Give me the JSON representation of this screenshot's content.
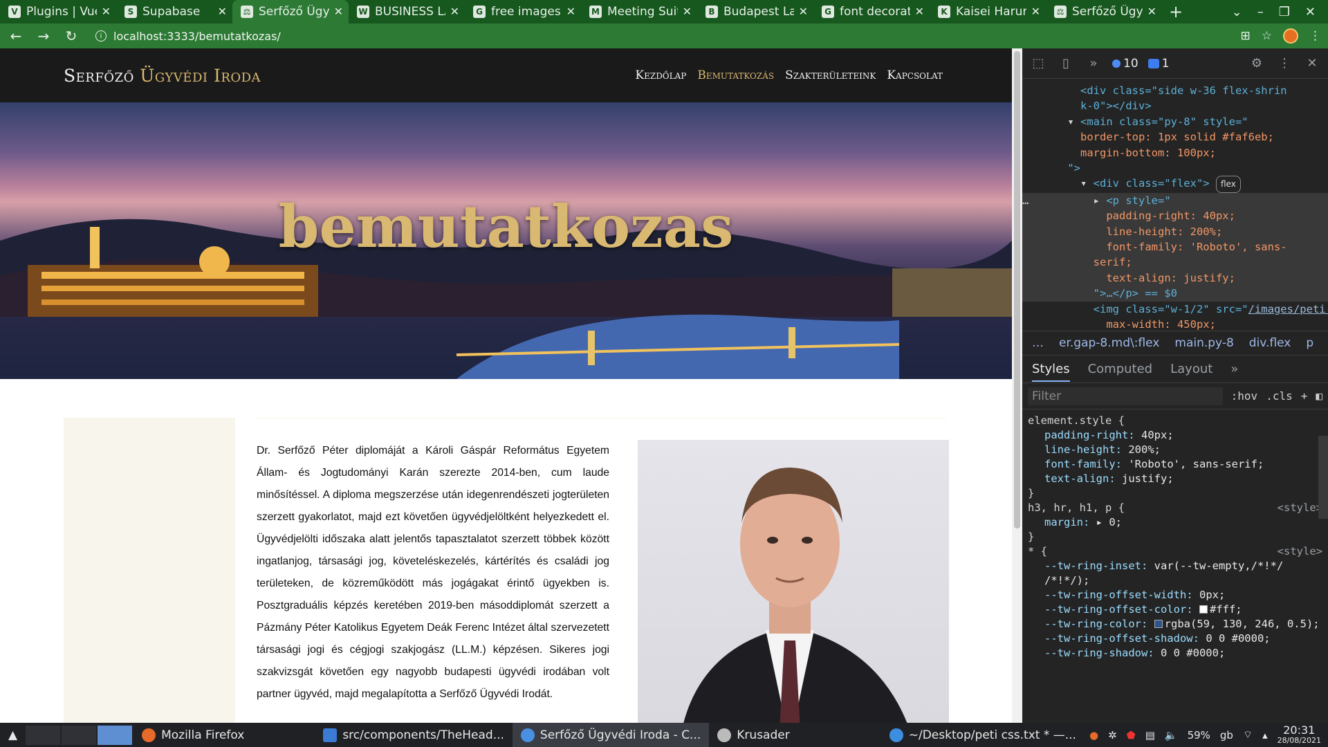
{
  "browser": {
    "tabs": [
      {
        "title": "Plugins | Vue.js",
        "favicon": "V"
      },
      {
        "title": "Supabase",
        "favicon": "S"
      },
      {
        "title": "Serfőző Ügyvédi Iroda",
        "favicon": "⚖",
        "active": true
      },
      {
        "title": "BUSINESS LAW",
        "favicon": "W"
      },
      {
        "title": "free images - G",
        "favicon": "G"
      },
      {
        "title": "Meeting Suit P",
        "favicon": "M"
      },
      {
        "title": "Budapest Law",
        "favicon": "B"
      },
      {
        "title": "font decoration",
        "favicon": "G"
      },
      {
        "title": "Kaisei Harunou",
        "favicon": "K"
      },
      {
        "title": "Serfőző Ügyvéd",
        "favicon": "⚖"
      }
    ],
    "url": "localhost:3333/bemutatkozas/"
  },
  "site": {
    "brand_part1": "Serfőző",
    "brand_part2": "Ügyvédi Iroda",
    "nav": [
      "Kezdőlap",
      "Bemutatkozás",
      "Szakterületeink",
      "Kapcsolat"
    ],
    "hero_title": "bemutatkozas",
    "bio": "Dr. Serfőző Péter diplomáját a Károli Gáspár Református Egyetem Állam- és Jogtudományi Karán szerezte 2014-ben, cum laude minősítéssel. A diploma megszerzése után idegenrendészeti jogterületen szerzett gyakorlatot, majd ezt követően ügyvédjelöltként helyezkedett el. Ügyvédjelölti időszaka alatt jelentős tapasztalatot szerzett többek között ingatlanjog, társasági jog, követeléskezelés, kártérítés és családi jog területeken, de közreműködött más jogágakat érintő ügyekben is. Posztgraduális képzés keretében 2019-ben másoddiplomát szerzett a Pázmány Péter Katolikus Egyetem Deák Ferenc Intézet által szervezetett társasági jogi és cégjogi szakjogász (LL.M.) képzésen. Sikeres jogi szakvizsgát követően egy nagyobb budapesti ügyvédi irodában volt partner ügyvéd, majd megalapította a Serfőző Ügyvédi Irodát."
  },
  "devtools": {
    "issues_count": "10",
    "messages_count": "1",
    "dom_lines": {
      "l0": "<div class=\"side w-36 flex-shrin",
      "l1": "k-0\"></div>",
      "main_open": "<main class=\"py-8\" style=\"",
      "main_s1": "border-top: 1px solid #faf6eb;",
      "main_s2": "margin-bottom: 100px;",
      "main_close": "\">",
      "div_flex": "<div class=\"flex\">",
      "flex_badge": "flex",
      "p_open": "<p style=\"",
      "p_s1": "padding-right: 40px;",
      "p_s2": "line-height: 200%;",
      "p_s3": "font-family: 'Roboto', sans-",
      "p_s4": "serif;",
      "p_s5": "text-align: justify;",
      "p_close": "\">…</p> == $0",
      "img_open": "<img class=\"w-1/2\" src=\"",
      "img_src": "/images/peti.jpg",
      "img_style": "\" style=\"",
      "img_s1": "max-width: 450px;",
      "img_close": "\">"
    },
    "breadcrumbs": [
      "…",
      "er.gap-8.md\\:flex",
      "main.py-8",
      "div.flex",
      "p",
      "…"
    ],
    "panel_tabs": [
      "Styles",
      "Computed",
      "Layout",
      "»"
    ],
    "filter_placeholder": "Filter",
    "filter_opts": [
      ":hov",
      ".cls",
      "+"
    ],
    "styles": {
      "element_selector": "element.style {",
      "element_props": [
        {
          "name": "padding-right",
          "value": "40px;"
        },
        {
          "name": "line-height",
          "value": "200%;"
        },
        {
          "name": "font-family",
          "value": "'Roboto', sans-serif;"
        },
        {
          "name": "text-align",
          "value": "justify;"
        }
      ],
      "rule2_selector": "h3, hr, h1, p {",
      "rule2_source": "<style>",
      "rule2_prop": {
        "name": "margin",
        "value": "▸ 0;"
      },
      "rule3_selector": "* {",
      "rule3_source": "<style>",
      "rule3_props": [
        {
          "name": "--tw-ring-inset",
          "value": "var(--tw-empty,/*!*/ /*!*/);"
        },
        {
          "name": "--tw-ring-offset-width",
          "value": "0px;"
        },
        {
          "name": "--tw-ring-offset-color",
          "value": "#fff;"
        },
        {
          "name": "--tw-ring-color",
          "value": "rgba(59, 130, 246, 0.5);"
        },
        {
          "name": "--tw-ring-offset-shadow",
          "value": "0 0 #0000;"
        },
        {
          "name": "--tw-ring-shadow",
          "value": "0 0 #0000;"
        }
      ],
      "close": "}"
    }
  },
  "taskbar": {
    "items": [
      "Mozilla Firefox",
      "src/components/TheHead...",
      "Serfőző Ügyvédi Iroda - C...",
      "Krusader",
      "~/Desktop/peti css.txt * —..."
    ],
    "battery": "59%",
    "keyboard": "gb",
    "time": "20:31",
    "date": "28/08/2021"
  },
  "colors": {
    "browser_frame": "#17581f",
    "accent_gold": "#d9b871",
    "site_header": "#1a1a1a"
  }
}
